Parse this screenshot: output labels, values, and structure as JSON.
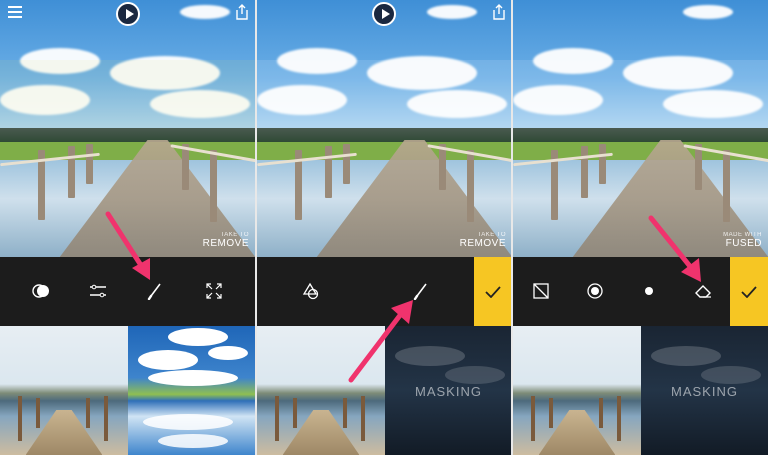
{
  "panels": [
    {
      "watermark_small": "TAKE TO",
      "watermark_big": "REMOVE",
      "tools": [
        "blend-mode-icon",
        "adjust-icon",
        "brush-icon",
        "expand-icon"
      ]
    },
    {
      "watermark_small": "TAKE TO",
      "watermark_big": "REMOVE",
      "tools": [
        "shapes-icon",
        "brush-icon"
      ],
      "masking_label": "MASKING"
    },
    {
      "watermark_small": "MADE WITH",
      "watermark_big": "FUSED",
      "tools": [
        "invert-mask-icon",
        "radial-icon",
        "dot-icon",
        "eraser-icon"
      ],
      "masking_label": "MASKING"
    }
  ],
  "colors": {
    "confirm_accent": "#f6c623",
    "arrow": "#f0336d",
    "toolbar_bg": "#1c1c1c"
  }
}
